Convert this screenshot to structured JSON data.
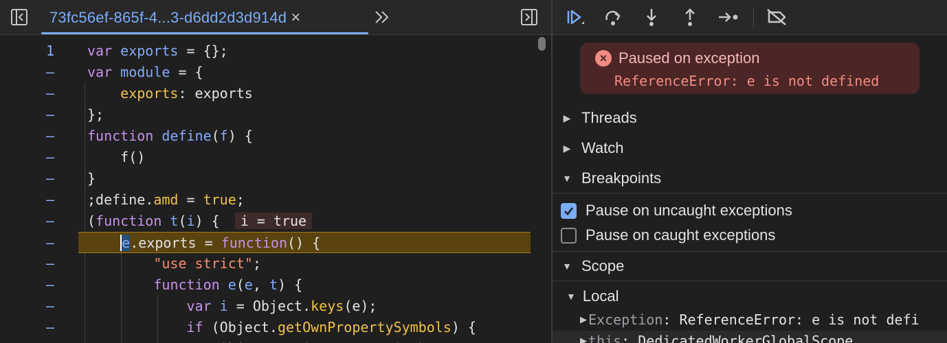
{
  "source": {
    "tab_title": "73fc56ef-865f-4...3-d6dd2d3d914d",
    "line_number_first": "1",
    "line_marker": "–",
    "lines": [
      {
        "parts": [
          [
            "kw",
            "var"
          ],
          [
            "val",
            " "
          ],
          [
            "fn",
            "exports"
          ],
          [
            "val",
            " = {};"
          ]
        ]
      },
      {
        "parts": [
          [
            "kw",
            "var"
          ],
          [
            "val",
            " "
          ],
          [
            "fn",
            "module"
          ],
          [
            "val",
            " = {"
          ]
        ]
      },
      {
        "parts": [
          [
            "val",
            "    "
          ],
          [
            "prop",
            "exports"
          ],
          [
            "val",
            ": exports"
          ]
        ]
      },
      {
        "parts": [
          [
            "val",
            "};"
          ]
        ]
      },
      {
        "parts": [
          [
            "kw",
            "function"
          ],
          [
            "val",
            " "
          ],
          [
            "fn",
            "define"
          ],
          [
            "val",
            "("
          ],
          [
            "fn",
            "f"
          ],
          [
            "val",
            ") {"
          ]
        ]
      },
      {
        "parts": [
          [
            "val",
            "    f()"
          ]
        ]
      },
      {
        "parts": [
          [
            "val",
            "}"
          ]
        ]
      },
      {
        "parts": [
          [
            "val",
            ";define."
          ],
          [
            "prop",
            "amd"
          ],
          [
            "val",
            " = "
          ],
          [
            "bool",
            "true"
          ],
          [
            "val",
            ";"
          ]
        ]
      },
      {
        "parts": [
          [
            "val",
            "("
          ],
          [
            "kw",
            "function"
          ],
          [
            "val",
            " "
          ],
          [
            "fn",
            "t"
          ],
          [
            "val",
            "("
          ],
          [
            "fn",
            "i"
          ],
          [
            "val",
            ") { "
          ]
        ],
        "inline_value": "i = true"
      },
      {
        "parts": [
          [
            "val",
            "    "
          ],
          [
            "cursor",
            "e"
          ],
          [
            "val",
            ".exports = "
          ],
          [
            "kw",
            "function"
          ],
          [
            "val",
            "() {"
          ]
        ],
        "current": true
      },
      {
        "parts": [
          [
            "val",
            "        "
          ],
          [
            "str",
            "\"use strict\""
          ],
          [
            "val",
            ";"
          ]
        ]
      },
      {
        "parts": [
          [
            "val",
            "        "
          ],
          [
            "kw",
            "function"
          ],
          [
            "val",
            " "
          ],
          [
            "fn",
            "e"
          ],
          [
            "val",
            "("
          ],
          [
            "fn",
            "e"
          ],
          [
            "val",
            ", "
          ],
          [
            "fn",
            "t"
          ],
          [
            "val",
            ") {"
          ]
        ]
      },
      {
        "parts": [
          [
            "val",
            "            "
          ],
          [
            "kw",
            "var"
          ],
          [
            "val",
            " "
          ],
          [
            "fn",
            "i"
          ],
          [
            "val",
            " = Object."
          ],
          [
            "prop",
            "keys"
          ],
          [
            "val",
            "(e);"
          ]
        ]
      },
      {
        "parts": [
          [
            "val",
            "            "
          ],
          [
            "kw",
            "if"
          ],
          [
            "val",
            " (Object."
          ],
          [
            "prop",
            "getOwnPropertySymbols"
          ],
          [
            "val",
            ") {"
          ]
        ]
      },
      {
        "parts": [
          [
            "val",
            "                "
          ],
          [
            "val",
            "Object."
          ],
          [
            "prop",
            "getOwnPropertySymb"
          ]
        ]
      }
    ]
  },
  "debugger": {
    "exception_title": "Paused on exception",
    "exception_message": "ReferenceError: e is not defined",
    "sections": {
      "threads": "Threads",
      "watch": "Watch",
      "breakpoints": "Breakpoints",
      "scope": "Scope"
    },
    "pause_uncaught": {
      "label": "Pause on uncaught exceptions",
      "checked": true
    },
    "pause_caught": {
      "label": "Pause on caught exceptions",
      "checked": false
    },
    "scope_local": "Local",
    "variables": [
      {
        "name": "Exception",
        "value": " ReferenceError: e is not defi"
      },
      {
        "name": "this",
        "value": " DedicatedWorkerGlobalScope"
      }
    ]
  },
  "icons": {
    "navigator": "sidebar-toggle-icon",
    "more_tabs": "chevron-double-right-icon",
    "debugger_sidebar": "sidebar-right-toggle-icon",
    "resume": "resume-icon",
    "step_over": "step-over-icon",
    "step_into": "step-into-icon",
    "step_out": "step-out-icon",
    "step": "step-icon",
    "deactivate_breakpoints": "deactivate-breakpoints-icon"
  },
  "colors": {
    "accent": "#7cacf8",
    "paused_line": "#5a430f",
    "exception_bg": "#4c2626",
    "exception_text": "#f28b82"
  }
}
